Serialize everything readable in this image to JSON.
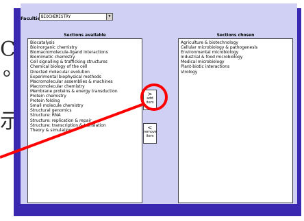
{
  "background": {
    "glyphs": [
      "C",
      "。",
      "示"
    ]
  },
  "panel": {
    "faculties_label": "Faculties:",
    "faculties_value": "BIOCHEMISTRY",
    "available_heading": "Sections available",
    "chosen_heading": "Sections chosen",
    "available_items": [
      "Biocatalysis",
      "Bioinorganic chemistry",
      "Biomacromolecule-ligand interactions",
      "Biomimetic chemistry",
      "Cell signalling & trafficking structures",
      "Chemical biology of the cell",
      "Directed molecular evolution",
      "Experimental biophysical methods",
      "Macromolecular assemblies & machines",
      "Macromolecular chemistry",
      "Membrane proteins & energy transduction",
      "Protein chemistry",
      "Protein folding",
      "Small molecule chemistry",
      "Structural genomics",
      "Structure: RNA",
      "Structure: replication & repair",
      "Structure: transcription & translation",
      "Theory & simulation"
    ],
    "chosen_items": [
      "Agriculture & biotechnology",
      "Cellular microbiology & pathogenesis",
      "Environmental microbiology",
      "Industrial & food microbiology",
      "Medical microbiology",
      "Plant-biotic interactions",
      "Virology"
    ],
    "add_button": {
      "arrow": ">",
      "line1": "add",
      "line2": "item"
    },
    "remove_button": {
      "arrow": "<",
      "line1": "remove",
      "line2": "item"
    }
  },
  "colors": {
    "panel_bg": "#cfd0f3",
    "shadow": "#3b28b0",
    "highlight": "#ff0000"
  }
}
